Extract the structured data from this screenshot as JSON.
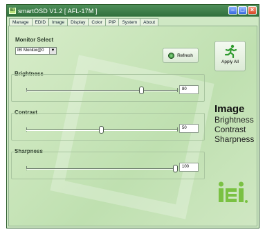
{
  "window": {
    "title": "smartOSD V1.2 [ AFL-17M ]",
    "app_icon": "IEi"
  },
  "tabs": [
    "Manage",
    "EDID",
    "Image",
    "Display",
    "Color",
    "PIP",
    "System",
    "About"
  ],
  "active_tab": "Image",
  "monitor_select": {
    "label": "Monitor Select",
    "value": "IEI Monitor@0",
    "refresh_label": "Refresh",
    "apply_label": "Apply All"
  },
  "controls": [
    {
      "label": "Brightness",
      "value": "80"
    },
    {
      "label": "Contrast",
      "value": "50"
    },
    {
      "label": "Sharpness",
      "value": "100"
    }
  ],
  "caption": {
    "title": "Image",
    "items": [
      "Brightness",
      "Contrast",
      "Sharpness"
    ]
  },
  "colors": {
    "accent_green": "#2f6f3c",
    "logo_green": "#7ac143"
  }
}
